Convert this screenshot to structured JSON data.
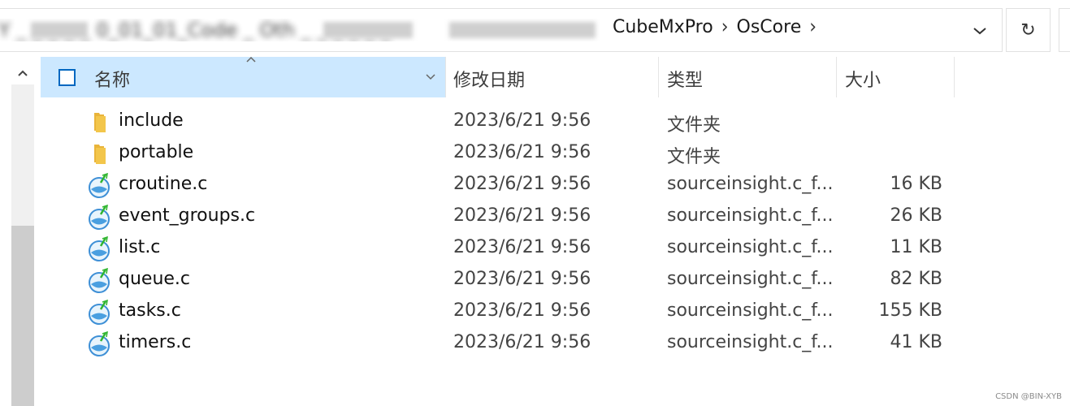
{
  "address_bar": {
    "obscured_path_fragment": "Y  _ _ _ _ _ 0_01_01_Code _ Oth _ _ _ _ _ _",
    "crumbs": [
      "CubeMxPro",
      "OsCore"
    ],
    "separator": "›",
    "refresh_glyph": "↻"
  },
  "columns": {
    "name": "名称",
    "date": "修改日期",
    "type": "类型",
    "size": "大小"
  },
  "files": [
    {
      "name": "include",
      "date": "2023/6/21 9:56",
      "type": "文件夹",
      "size": "",
      "icon": "folder-icon"
    },
    {
      "name": "portable",
      "date": "2023/6/21 9:56",
      "type": "文件夹",
      "size": "",
      "icon": "folder-icon"
    },
    {
      "name": "croutine.c",
      "date": "2023/6/21 9:56",
      "type": "sourceinsight.c_f...",
      "size": "16 KB",
      "icon": "source-file-icon"
    },
    {
      "name": "event_groups.c",
      "date": "2023/6/21 9:56",
      "type": "sourceinsight.c_f...",
      "size": "26 KB",
      "icon": "source-file-icon"
    },
    {
      "name": "list.c",
      "date": "2023/6/21 9:56",
      "type": "sourceinsight.c_f...",
      "size": "11 KB",
      "icon": "source-file-icon"
    },
    {
      "name": "queue.c",
      "date": "2023/6/21 9:56",
      "type": "sourceinsight.c_f...",
      "size": "82 KB",
      "icon": "source-file-icon"
    },
    {
      "name": "tasks.c",
      "date": "2023/6/21 9:56",
      "type": "sourceinsight.c_f...",
      "size": "155 KB",
      "icon": "source-file-icon"
    },
    {
      "name": "timers.c",
      "date": "2023/6/21 9:56",
      "type": "sourceinsight.c_f...",
      "size": "41 KB",
      "icon": "source-file-icon"
    }
  ],
  "colors": {
    "header_selected": "#cce8ff",
    "checkbox_border": "#0067c0",
    "folder": "#f3c64b",
    "source_icon": "#4a9fe0"
  },
  "watermark": "CSDN @BIN-XYB"
}
